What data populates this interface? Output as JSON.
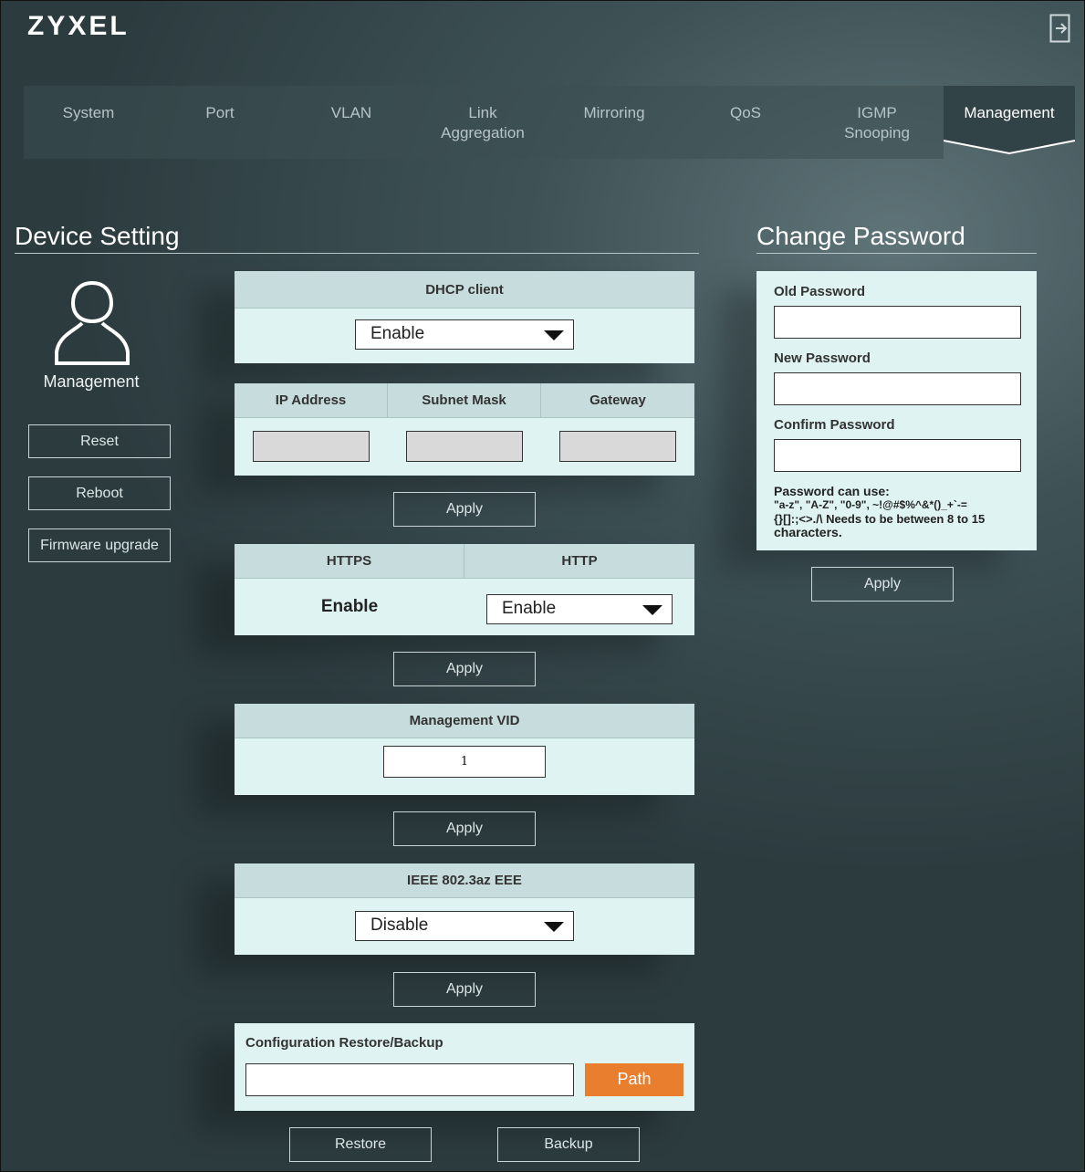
{
  "header": {
    "logo": "ZYXEL",
    "logout_icon": "logout-icon"
  },
  "nav": {
    "system": "System",
    "port": "Port",
    "vlan": "VLAN",
    "link_agg_1": "Link",
    "link_agg_2": "Aggregation",
    "mirroring": "Mirroring",
    "qos": "QoS",
    "igmp_1": "IGMP",
    "igmp_2": "Snooping",
    "management": "Management"
  },
  "device_setting": {
    "title": "Device Setting",
    "profile_label": "Management",
    "reset": "Reset",
    "reboot": "Reboot",
    "firmware": "Firmware upgrade"
  },
  "dhcp": {
    "title": "DHCP client",
    "value": "Enable"
  },
  "ip": {
    "ip_header": "IP Address",
    "mask_header": "Subnet Mask",
    "gateway_header": "Gateway",
    "ip_value": "",
    "mask_value": "",
    "gateway_value": "",
    "apply": "Apply"
  },
  "protocol": {
    "https_header": "HTTPS",
    "http_header": "HTTP",
    "https_value": "Enable",
    "http_value": "Enable",
    "apply": "Apply"
  },
  "vid": {
    "title": "Management VID",
    "value": "1",
    "apply": "Apply"
  },
  "eee": {
    "title": "IEEE 802.3az EEE",
    "value": "Disable",
    "apply": "Apply"
  },
  "config": {
    "title": "Configuration Restore/Backup",
    "path_value": "",
    "path_button": "Path",
    "restore": "Restore",
    "backup": "Backup"
  },
  "password": {
    "title": "Change Password",
    "old_label": "Old Password",
    "new_label": "New Password",
    "confirm_label": "Confirm Password",
    "hint_title": "Password can use:",
    "hint_line1": "\"a-z\", \"A-Z\", \"0-9\", ~!@#$%^&*()_+`-=",
    "hint_line2": "{}[]:;<>./\\ Needs to be between 8 to 15",
    "hint_line3": "characters.",
    "apply": "Apply"
  },
  "colors": {
    "accent": "#e87e2e",
    "panel": "#dff3f3",
    "panel_header": "#c7dcdc"
  }
}
